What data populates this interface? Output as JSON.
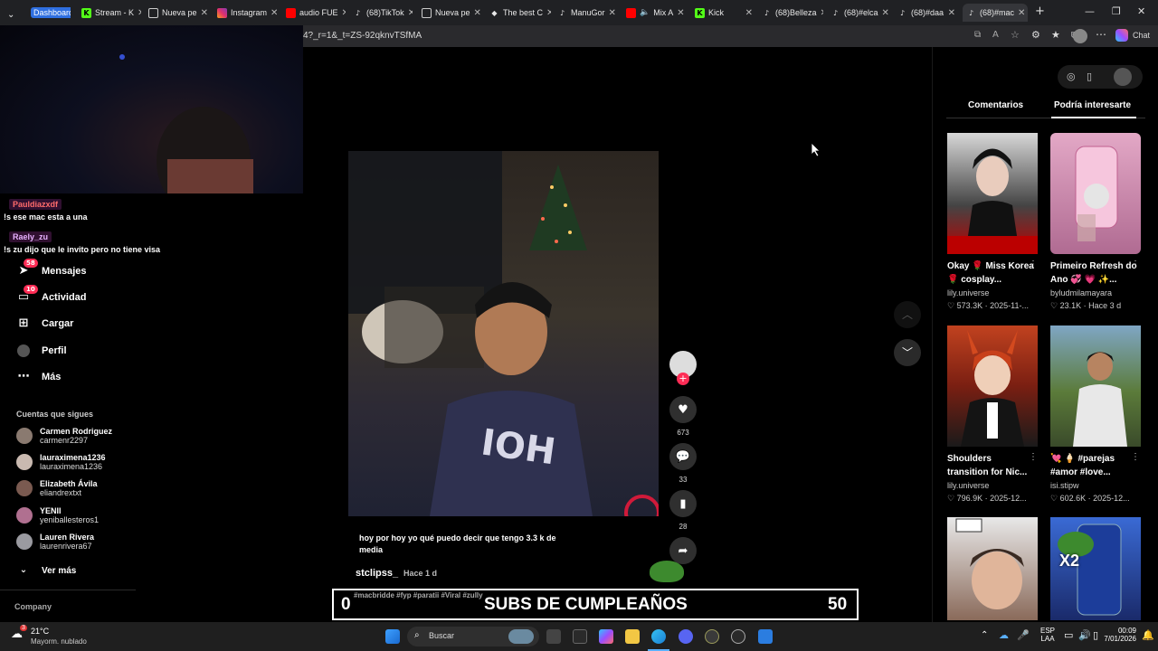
{
  "tabs": [
    {
      "label": "Dashboard",
      "icon": "dashboard-badge"
    },
    {
      "label": "Stream - K",
      "icon": "kick-icon"
    },
    {
      "label": "Nueva pe",
      "icon": "tab-page-icon"
    },
    {
      "label": "Instagram",
      "icon": "instagram-icon"
    },
    {
      "label": "audio FUE",
      "icon": "youtube-icon"
    },
    {
      "label": "(68)TikTok",
      "icon": "tiktok-icon"
    },
    {
      "label": "Nueva pe",
      "icon": "tab-page-icon"
    },
    {
      "label": "The best C",
      "icon": "github-icon"
    },
    {
      "label": "ManuGor",
      "icon": "tiktok-icon"
    },
    {
      "label": "Mix A",
      "icon": "youtube-icon"
    },
    {
      "label": "Kick",
      "icon": "kick-icon"
    },
    {
      "label": "(68)Belleza",
      "icon": "tiktok-icon"
    },
    {
      "label": "(68)#elca",
      "icon": "tiktok-icon"
    },
    {
      "label": "(68)#daa",
      "icon": "tiktok-icon"
    },
    {
      "label": "(68)#mac",
      "icon": "tiktok-icon"
    }
  ],
  "address": {
    "url": "4?_r=1&_t=ZS-92qknvTSfMA",
    "chat_label": "Chat"
  },
  "chat": [
    {
      "user": "Pauldiazxdf",
      "message": "!s ese mac esta a una"
    },
    {
      "user": "Raely_zu",
      "message": "!s zu dijo que le invito pero no tiene visa"
    }
  ],
  "nav": [
    {
      "label": "Mensajes",
      "icon": "send-icon",
      "badge": "58"
    },
    {
      "label": "Actividad",
      "icon": "inbox-icon",
      "badge": "10"
    },
    {
      "label": "Cargar",
      "icon": "upload-icon",
      "badge": ""
    },
    {
      "label": "Perfil",
      "icon": "avatar-icon",
      "badge": ""
    },
    {
      "label": "Más",
      "icon": "more-icon",
      "badge": ""
    }
  ],
  "following_header": "Cuentas que sigues",
  "following": [
    {
      "name": "Carmen Rodriguez",
      "handle": "carmenr2297"
    },
    {
      "name": "lauraximena1236",
      "handle": "lauraximena1236"
    },
    {
      "name": "Elizabeth Ávila",
      "handle": "eliandrextxt"
    },
    {
      "name": "YENII",
      "handle": "yeniballesteros1"
    },
    {
      "name": "Lauren Rivera",
      "handle": "laurenrivera67"
    }
  ],
  "see_more": "Ver más",
  "company": "Company",
  "video": {
    "caption": "hoy por hoy yo qué puedo decir que tengo 3.3 k de media",
    "author": "stclipss_",
    "time": "Hace 1 d",
    "hashtags": "#macbridde #fyp #paratii #Viral #zully",
    "likes": "673",
    "comments": "33",
    "saves": "28"
  },
  "overlay": {
    "left_count": "0",
    "title": "SUBS DE CUMPLEAÑOS",
    "right_count": "50",
    "progress": 0.0
  },
  "right_tabs": {
    "comments": "Comentarios",
    "recommended": "Podría interesarte"
  },
  "recommended": [
    {
      "title": "Okay 🌹 Miss Korea 🌹 cosplay...",
      "author": "lily.universe",
      "likes": "573.3K",
      "date": "2025-11-..."
    },
    {
      "title": "Primeiro Refresh do Ano 💞 💗 ✨...",
      "author": "byludmilamayara",
      "likes": "23.1K",
      "date": "Hace 3 d"
    },
    {
      "title": "Shoulders transition for Nic...",
      "author": "lily.universe",
      "likes": "796.9K",
      "date": "2025-12..."
    },
    {
      "title": "💘 🍦 #parejas #amor #love...",
      "author": "isi.stipw",
      "likes": "602.6K",
      "date": "2025-12..."
    },
    {
      "title": "",
      "author": "",
      "likes": "",
      "date": ""
    },
    {
      "title": "",
      "author": "",
      "likes": "",
      "date": ""
    }
  ],
  "thumb_texts": {
    "x2": "X2"
  },
  "taskbar": {
    "weather_temp": "21°C",
    "weather_desc": "Mayorm. nublado",
    "search": "Buscar",
    "lang1": "ESP",
    "lang2": "LAA",
    "time": "00:09",
    "date": "7/01/2026",
    "weather_badge": "3"
  },
  "colors": {
    "accent": "#fe2c55",
    "tab_active": "#35363a",
    "dashboard_badge": "#2f6fe0"
  }
}
